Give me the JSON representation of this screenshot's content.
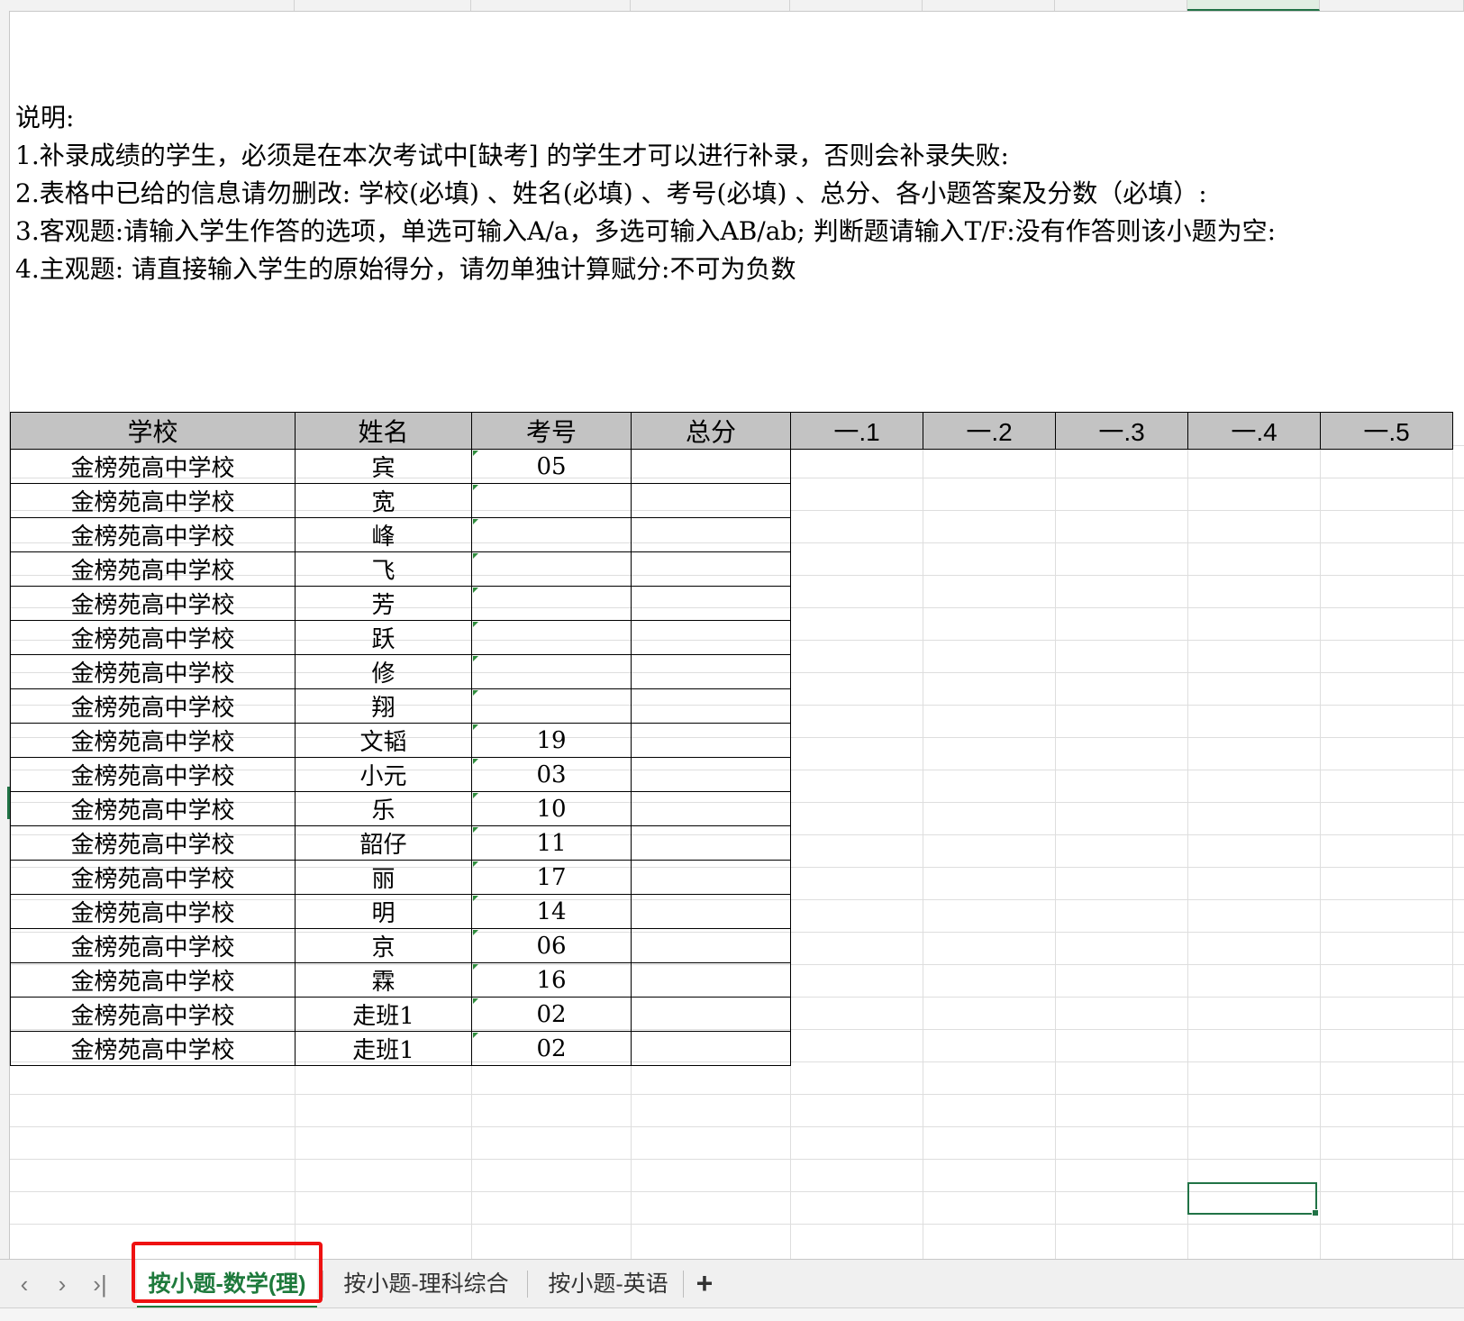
{
  "notes": {
    "title": "说明:",
    "line1": "1.补录成绩的学生，必须是在本次考试中[缺考] 的学生才可以进行补录，否则会补录失败:",
    "line2": "2.表格中已给的信息请勿删改: 学校(必填) 、姓名(必填) 、考号(必填) 、总分、各小题答案及分数（必填）:",
    "line3": "3.客观题:请输入学生作答的选项，单选可输入A/a，多选可输入AB/ab; 判断题请输入T/F:没有作答则该小题为空:",
    "line4": "4.主观题: 请直接输入学生的原始得分，请勿单独计算赋分:不可为负数"
  },
  "table": {
    "headers": [
      "学校",
      "姓名",
      "考号",
      "总分",
      "一.1",
      "一.2",
      "一.3",
      "一.4",
      "一.5"
    ],
    "rows": [
      {
        "school": "金榜苑高中学校",
        "name": "宾",
        "id": "05"
      },
      {
        "school": "金榜苑高中学校",
        "name": "宽",
        "id": ""
      },
      {
        "school": "金榜苑高中学校",
        "name": "峰",
        "id": ""
      },
      {
        "school": "金榜苑高中学校",
        "name": "飞",
        "id": ""
      },
      {
        "school": "金榜苑高中学校",
        "name": "芳",
        "id": ""
      },
      {
        "school": "金榜苑高中学校",
        "name": "跃",
        "id": ""
      },
      {
        "school": "金榜苑高中学校",
        "name": "修",
        "id": ""
      },
      {
        "school": "金榜苑高中学校",
        "name": "翔",
        "id": ""
      },
      {
        "school": "金榜苑高中学校",
        "name": "文韬",
        "id": "19"
      },
      {
        "school": "金榜苑高中学校",
        "name": "小元",
        "id": "03"
      },
      {
        "school": "金榜苑高中学校",
        "name": "乐",
        "id": "10"
      },
      {
        "school": "金榜苑高中学校",
        "name": "韶仔",
        "id": "11"
      },
      {
        "school": "金榜苑高中学校",
        "name": "丽",
        "id": "17"
      },
      {
        "school": "金榜苑高中学校",
        "name": "明",
        "id": "14"
      },
      {
        "school": "金榜苑高中学校",
        "name": "京",
        "id": "06"
      },
      {
        "school": "金榜苑高中学校",
        "name": "霖",
        "id": "16"
      },
      {
        "school": "金榜苑高中学校",
        "name": "走班1",
        "id": "02"
      },
      {
        "school": "金榜苑高中学校",
        "name": "走班1",
        "id": "02"
      }
    ]
  },
  "tabs": {
    "tab1": "按小题-数学(理)",
    "tab2": "按小题-理科综合",
    "tab3": "按小题-英语",
    "add": "+"
  },
  "nav": {
    "prev": "‹",
    "next": "›",
    "last": "›|"
  },
  "colors": {
    "accent_green": "#1e7a3c",
    "highlight_red": "#ee1111",
    "header_gray": "#c3c3c3"
  }
}
